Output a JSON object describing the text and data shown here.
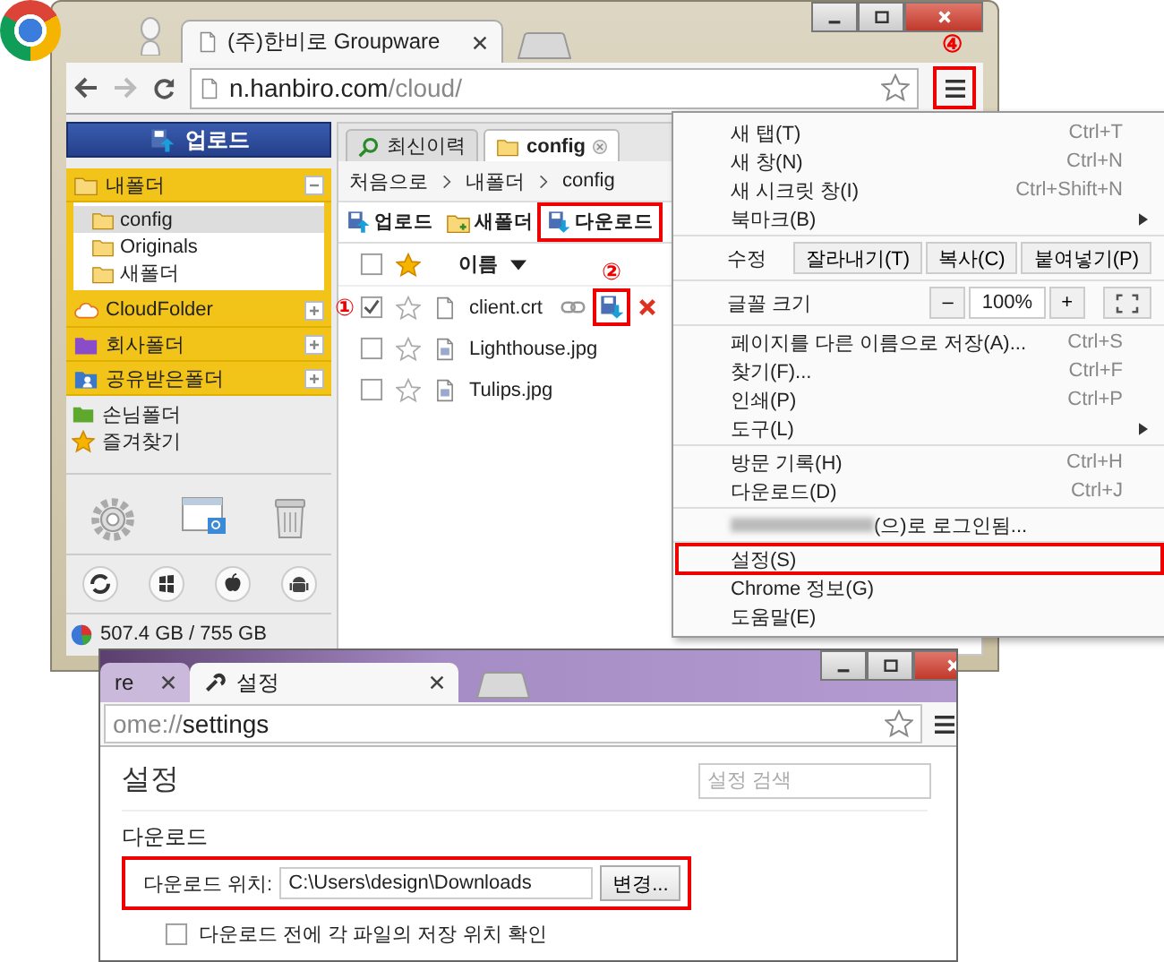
{
  "browser": {
    "tabs": [
      {
        "title": "(주)한비로 Groupware",
        "selected": true
      }
    ],
    "url_host": "n.hanbiro.com",
    "url_path": "/cloud/",
    "menu_button": {
      "highlighted": true,
      "callout": "④"
    }
  },
  "sidebar": {
    "upload_button": "업로드",
    "sections": [
      {
        "label": "내폴더",
        "kind": "folder",
        "expanded": true,
        "children": [
          {
            "label": "config",
            "selected": true
          },
          {
            "label": "Originals",
            "selected": false
          },
          {
            "label": "새폴더",
            "selected": false
          }
        ]
      },
      {
        "label": "CloudFolder",
        "kind": "cloud",
        "expanded": false
      },
      {
        "label": "회사폴더",
        "kind": "company",
        "expanded": false
      },
      {
        "label": "공유받은폴더",
        "kind": "shared",
        "expanded": false
      }
    ],
    "links": [
      {
        "label": "손님폴더",
        "kind": "guest"
      },
      {
        "label": "즐겨찾기",
        "kind": "favorites"
      }
    ],
    "storage": "507.4 GB / 755 GB"
  },
  "file_panel": {
    "tabs": [
      {
        "label": "최신이력",
        "kind": "history",
        "selected": false
      },
      {
        "label": "config",
        "kind": "folder",
        "selected": true
      }
    ],
    "breadcrumb": [
      "처음으로",
      "내폴더",
      "config"
    ],
    "toolbar": [
      {
        "label": "업로드",
        "kind": "upload",
        "highlighted": false
      },
      {
        "label": "새폴더",
        "kind": "new-folder",
        "highlighted": false
      },
      {
        "label": "다운로드",
        "kind": "download",
        "highlighted": true
      }
    ],
    "header": {
      "name": "이름",
      "checked": false
    },
    "files": [
      {
        "name": "client.crt",
        "kind": "file",
        "checked": true,
        "callout": "①",
        "actions": [
          {
            "kind": "link",
            "highlighted": false
          },
          {
            "kind": "download",
            "highlighted": true,
            "callout": "②"
          },
          {
            "kind": "delete",
            "highlighted": false
          }
        ]
      },
      {
        "name": "Lighthouse.jpg",
        "kind": "image",
        "checked": false
      },
      {
        "name": "Tulips.jpg",
        "kind": "image",
        "checked": false
      }
    ]
  },
  "menu": {
    "sections": [
      [
        {
          "kind": "item",
          "label": "새 탭(T)",
          "shortcut": "Ctrl+T",
          "submenu": false,
          "highlighted": false,
          "redacted": false
        },
        {
          "kind": "item",
          "label": "새 창(N)",
          "shortcut": "Ctrl+N",
          "submenu": false,
          "highlighted": false,
          "redacted": false
        },
        {
          "kind": "item",
          "label": "새 시크릿 창(I)",
          "shortcut": "Ctrl+Shift+N",
          "submenu": false,
          "highlighted": false,
          "redacted": false
        },
        {
          "kind": "item",
          "label": "북마크(B)",
          "submenu": true,
          "highlighted": false,
          "redacted": false
        }
      ],
      [
        {
          "kind": "edit",
          "label": "수정",
          "buttons": [
            "잘라내기(T)",
            "복사(C)",
            "붙여넣기(P)"
          ]
        }
      ],
      [
        {
          "kind": "zoom",
          "label": "글꼴 크기",
          "minus": "–",
          "value": "100%",
          "plus": "+"
        }
      ],
      [
        {
          "kind": "item",
          "label": "페이지를 다른 이름으로 저장(A)...",
          "shortcut": "Ctrl+S",
          "submenu": false,
          "highlighted": false,
          "redacted": false
        },
        {
          "kind": "item",
          "label": "찾기(F)...",
          "shortcut": "Ctrl+F",
          "submenu": false,
          "highlighted": false,
          "redacted": false
        },
        {
          "kind": "item",
          "label": "인쇄(P)",
          "shortcut": "Ctrl+P",
          "submenu": false,
          "highlighted": false,
          "redacted": false
        },
        {
          "kind": "item",
          "label": "도구(L)",
          "submenu": true,
          "highlighted": false,
          "redacted": false
        }
      ],
      [
        {
          "kind": "item",
          "label": "방문 기록(H)",
          "shortcut": "Ctrl+H",
          "submenu": false,
          "highlighted": false,
          "redacted": false
        },
        {
          "kind": "item",
          "label": "다운로드(D)",
          "shortcut": "Ctrl+J",
          "submenu": false,
          "highlighted": false,
          "redacted": false
        }
      ],
      [
        {
          "kind": "item",
          "label": "(으)로 로그인됨...",
          "submenu": false,
          "highlighted": false,
          "redacted": true
        }
      ],
      [
        {
          "kind": "item",
          "label": "설정(S)",
          "submenu": false,
          "highlighted": true,
          "redacted": false
        },
        {
          "kind": "item",
          "label": "Chrome 정보(G)",
          "submenu": false,
          "highlighted": false,
          "redacted": false
        },
        {
          "kind": "item",
          "label": "도움말(E)",
          "submenu": false,
          "highlighted": false,
          "redacted": false
        }
      ]
    ]
  },
  "settings_window": {
    "tabs": [
      {
        "title": "re",
        "kind": "page",
        "selected": false
      },
      {
        "title": "설정",
        "kind": "settings",
        "selected": true
      }
    ],
    "url_scheme": "ome://",
    "url_path": "settings",
    "heading": "설정",
    "search_placeholder": "설정 검색",
    "section": "다운로드",
    "location": {
      "label": "다운로드 위치:",
      "value": "C:\\Users\\design\\Downloads",
      "button": "변경...",
      "highlighted": true
    },
    "ask_checkbox": {
      "label": "다운로드 전에 각 파일의 저장 위치 확인",
      "checked": false
    }
  }
}
